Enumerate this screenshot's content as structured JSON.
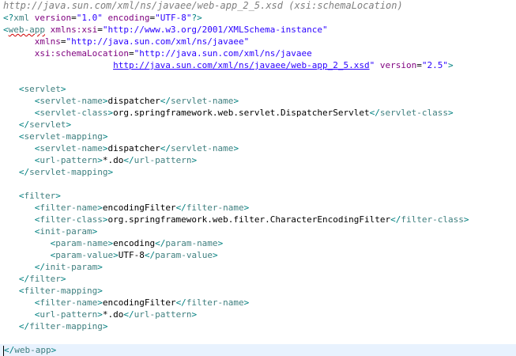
{
  "header": {
    "schema_location_text": "http://java.sun.com/xml/ns/javaee/web-app_2_5.xsd (xsi:schemaLocation)"
  },
  "editor": {
    "lines": [
      [
        {
          "t": "<?",
          "c": "bracket"
        },
        {
          "t": "xml",
          "c": "tag"
        },
        {
          "t": " version",
          "c": "attr"
        },
        {
          "t": "=",
          "c": "eq"
        },
        {
          "t": "\"1.0\"",
          "c": "val"
        },
        {
          "t": " encoding",
          "c": "attr"
        },
        {
          "t": "=",
          "c": "eq"
        },
        {
          "t": "\"UTF-8\"",
          "c": "val"
        },
        {
          "t": "?>",
          "c": "bracket"
        }
      ],
      [
        {
          "t": "<",
          "c": "bracket"
        },
        {
          "t": "web-app",
          "c": "tag",
          "u": "squiggle"
        },
        {
          "t": " xmlns:xsi",
          "c": "attr"
        },
        {
          "t": "=",
          "c": "eq"
        },
        {
          "t": "\"http://www.w3.org/2001/XMLSchema-instance\"",
          "c": "val"
        }
      ],
      [
        {
          "t": "      xmlns",
          "c": "attr"
        },
        {
          "t": "=",
          "c": "eq"
        },
        {
          "t": "\"http://java.sun.com/xml/ns/javaee\"",
          "c": "val"
        }
      ],
      [
        {
          "t": "      xsi:schemaLocation",
          "c": "attr"
        },
        {
          "t": "=",
          "c": "eq"
        },
        {
          "t": "\"http://java.sun.com/xml/ns/javaee",
          "c": "val"
        }
      ],
      [
        {
          "t": "                     ",
          "c": "text"
        },
        {
          "t": "http://java.sun.com/xml/ns/javaee/web-app_2_5.xsd",
          "c": "val",
          "u": "link"
        },
        {
          "t": "\"",
          "c": "val"
        },
        {
          "t": " version",
          "c": "attr"
        },
        {
          "t": "=",
          "c": "eq"
        },
        {
          "t": "\"2.5\"",
          "c": "val"
        },
        {
          "t": ">",
          "c": "bracket"
        }
      ],
      [],
      [
        {
          "t": "   <",
          "c": "bracket"
        },
        {
          "t": "servlet",
          "c": "tag"
        },
        {
          "t": ">",
          "c": "bracket"
        }
      ],
      [
        {
          "t": "      <",
          "c": "bracket"
        },
        {
          "t": "servlet-name",
          "c": "tag"
        },
        {
          "t": ">",
          "c": "bracket"
        },
        {
          "t": "dispatcher",
          "c": "text"
        },
        {
          "t": "</",
          "c": "bracket"
        },
        {
          "t": "servlet-name",
          "c": "tag"
        },
        {
          "t": ">",
          "c": "bracket"
        }
      ],
      [
        {
          "t": "      <",
          "c": "bracket"
        },
        {
          "t": "servlet-class",
          "c": "tag"
        },
        {
          "t": ">",
          "c": "bracket"
        },
        {
          "t": "org.springframework.web.servlet.DispatcherServlet",
          "c": "text"
        },
        {
          "t": "</",
          "c": "bracket"
        },
        {
          "t": "servlet-class",
          "c": "tag"
        },
        {
          "t": ">",
          "c": "bracket"
        }
      ],
      [
        {
          "t": "   </",
          "c": "bracket"
        },
        {
          "t": "servlet",
          "c": "tag"
        },
        {
          "t": ">",
          "c": "bracket"
        }
      ],
      [
        {
          "t": "   <",
          "c": "bracket"
        },
        {
          "t": "servlet-mapping",
          "c": "tag"
        },
        {
          "t": ">",
          "c": "bracket"
        }
      ],
      [
        {
          "t": "      <",
          "c": "bracket"
        },
        {
          "t": "servlet-name",
          "c": "tag"
        },
        {
          "t": ">",
          "c": "bracket"
        },
        {
          "t": "dispatcher",
          "c": "text"
        },
        {
          "t": "</",
          "c": "bracket"
        },
        {
          "t": "servlet-name",
          "c": "tag"
        },
        {
          "t": ">",
          "c": "bracket"
        }
      ],
      [
        {
          "t": "      <",
          "c": "bracket"
        },
        {
          "t": "url-pattern",
          "c": "tag"
        },
        {
          "t": ">",
          "c": "bracket"
        },
        {
          "t": "*.do",
          "c": "text"
        },
        {
          "t": "</",
          "c": "bracket"
        },
        {
          "t": "url-pattern",
          "c": "tag"
        },
        {
          "t": ">",
          "c": "bracket"
        }
      ],
      [
        {
          "t": "   </",
          "c": "bracket"
        },
        {
          "t": "servlet-mapping",
          "c": "tag"
        },
        {
          "t": ">",
          "c": "bracket"
        }
      ],
      [],
      [
        {
          "t": "   <",
          "c": "bracket"
        },
        {
          "t": "filter",
          "c": "tag"
        },
        {
          "t": ">",
          "c": "bracket"
        }
      ],
      [
        {
          "t": "      <",
          "c": "bracket"
        },
        {
          "t": "filter-name",
          "c": "tag"
        },
        {
          "t": ">",
          "c": "bracket"
        },
        {
          "t": "encodingFilter",
          "c": "text"
        },
        {
          "t": "</",
          "c": "bracket"
        },
        {
          "t": "filter-name",
          "c": "tag"
        },
        {
          "t": ">",
          "c": "bracket"
        }
      ],
      [
        {
          "t": "      <",
          "c": "bracket"
        },
        {
          "t": "filter-class",
          "c": "tag"
        },
        {
          "t": ">",
          "c": "bracket"
        },
        {
          "t": "org.springframework.web.filter.CharacterEncodingFilter",
          "c": "text"
        },
        {
          "t": "</",
          "c": "bracket"
        },
        {
          "t": "filter-class",
          "c": "tag"
        },
        {
          "t": ">",
          "c": "bracket"
        }
      ],
      [
        {
          "t": "      <",
          "c": "bracket"
        },
        {
          "t": "init-param",
          "c": "tag"
        },
        {
          "t": ">",
          "c": "bracket"
        }
      ],
      [
        {
          "t": "         <",
          "c": "bracket"
        },
        {
          "t": "param-name",
          "c": "tag"
        },
        {
          "t": ">",
          "c": "bracket"
        },
        {
          "t": "encoding",
          "c": "text"
        },
        {
          "t": "</",
          "c": "bracket"
        },
        {
          "t": "param-name",
          "c": "tag"
        },
        {
          "t": ">",
          "c": "bracket"
        }
      ],
      [
        {
          "t": "         <",
          "c": "bracket"
        },
        {
          "t": "param-value",
          "c": "tag"
        },
        {
          "t": ">",
          "c": "bracket"
        },
        {
          "t": "UTF-8",
          "c": "text"
        },
        {
          "t": "</",
          "c": "bracket"
        },
        {
          "t": "param-value",
          "c": "tag"
        },
        {
          "t": ">",
          "c": "bracket"
        }
      ],
      [
        {
          "t": "      </",
          "c": "bracket"
        },
        {
          "t": "init-param",
          "c": "tag"
        },
        {
          "t": ">",
          "c": "bracket"
        }
      ],
      [
        {
          "t": "   </",
          "c": "bracket"
        },
        {
          "t": "filter",
          "c": "tag"
        },
        {
          "t": ">",
          "c": "bracket"
        }
      ],
      [
        {
          "t": "   <",
          "c": "bracket"
        },
        {
          "t": "filter-mapping",
          "c": "tag"
        },
        {
          "t": ">",
          "c": "bracket"
        }
      ],
      [
        {
          "t": "      <",
          "c": "bracket"
        },
        {
          "t": "filter-name",
          "c": "tag"
        },
        {
          "t": ">",
          "c": "bracket"
        },
        {
          "t": "encodingFilter",
          "c": "text"
        },
        {
          "t": "</",
          "c": "bracket"
        },
        {
          "t": "filter-name",
          "c": "tag"
        },
        {
          "t": ">",
          "c": "bracket"
        }
      ],
      [
        {
          "t": "      <",
          "c": "bracket"
        },
        {
          "t": "url-pattern",
          "c": "tag"
        },
        {
          "t": ">",
          "c": "bracket"
        },
        {
          "t": "*.do",
          "c": "text"
        },
        {
          "t": "</",
          "c": "bracket"
        },
        {
          "t": "url-pattern",
          "c": "tag"
        },
        {
          "t": ">",
          "c": "bracket"
        }
      ],
      [
        {
          "t": "   </",
          "c": "bracket"
        },
        {
          "t": "filter-mapping",
          "c": "tag"
        },
        {
          "t": ">",
          "c": "bracket"
        }
      ],
      [],
      [
        {
          "t": "</",
          "c": "bracket",
          "caret": true
        },
        {
          "t": "web-app",
          "c": "tag"
        },
        {
          "t": ">",
          "c": "bracket"
        }
      ]
    ],
    "current_line": 28
  }
}
